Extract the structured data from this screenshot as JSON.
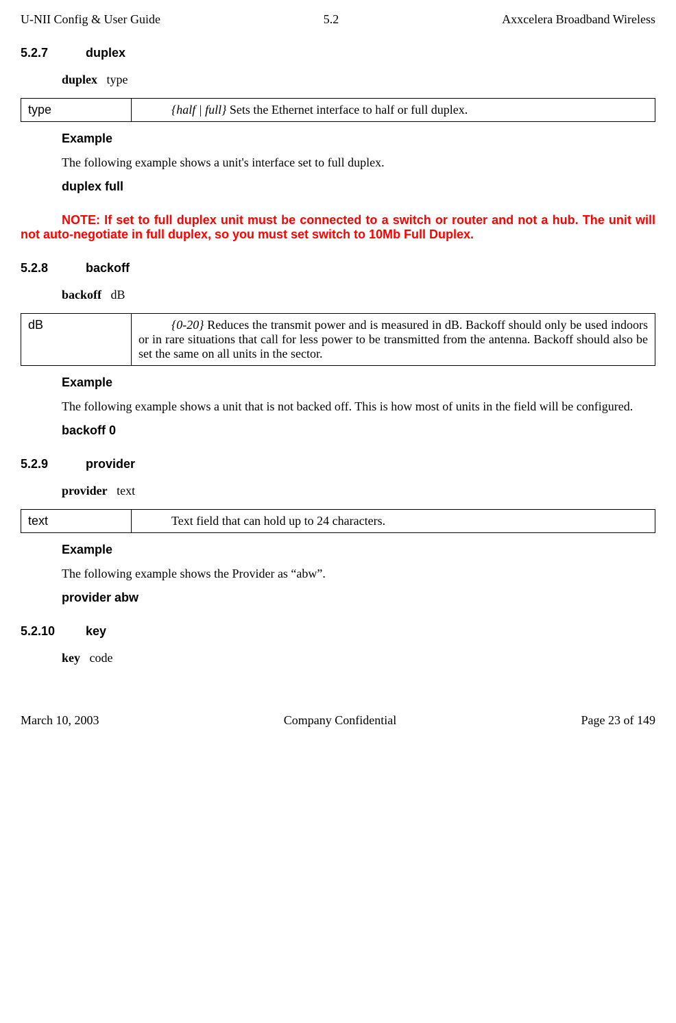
{
  "header": {
    "left": "U-NII Config & User Guide",
    "center": "5.2",
    "right": "Axxcelera Broadband Wireless"
  },
  "s527": {
    "num": "5.2.7",
    "title": "duplex",
    "syntax_cmd": "duplex",
    "syntax_arg": "type",
    "param_key": "type",
    "param_range": "{half | full}",
    "param_desc": " Sets the Ethernet interface to half or full duplex.",
    "example_label": "Example",
    "example_text": "The following example shows a unit's interface set to full duplex.",
    "example_cmd": "duplex   full",
    "note": "NOTE: If set to full duplex unit must be connected to a switch or router and not a hub. The unit will not auto-negotiate in full duplex, so you must set switch to 10Mb Full Duplex."
  },
  "s528": {
    "num": "5.2.8",
    "title": "backoff",
    "syntax_cmd": "backoff",
    "syntax_arg": "dB",
    "param_key": "dB",
    "param_range": "{0-20}",
    "param_desc": " Reduces the transmit power and is measured in dB. Backoff should only be used indoors or in rare situations that call for less power to be transmitted from the antenna. Backoff should also be set the same on all units in the sector.",
    "example_label": "Example",
    "example_text": "The following example shows a unit that is not backed off. This is how most of units in the field will be configured.",
    "example_cmd": "backoff   0"
  },
  "s529": {
    "num": "5.2.9",
    "title": "provider",
    "syntax_cmd": "provider",
    "syntax_arg": "text",
    "param_key": "text",
    "param_desc": "Text field that can hold up to 24 characters.",
    "example_label": "Example",
    "example_text": "The following example shows the Provider as “abw”.",
    "example_cmd": "provider   abw"
  },
  "s5210": {
    "num": "5.2.10",
    "title": "key",
    "syntax_cmd": "key",
    "syntax_arg": "code"
  },
  "footer": {
    "left": "March 10, 2003",
    "center": "Company Confidential",
    "right": "Page 23 of 149"
  }
}
